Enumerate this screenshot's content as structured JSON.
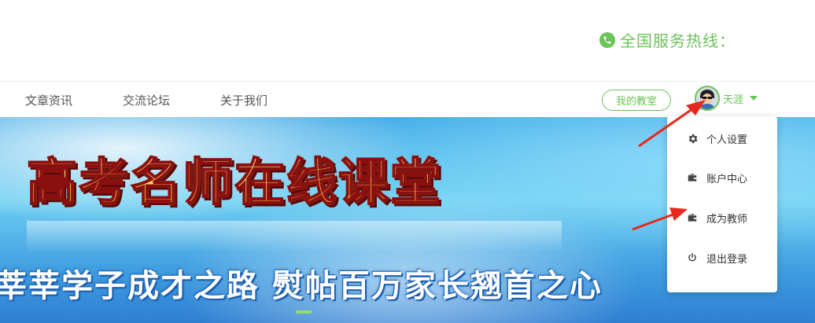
{
  "header": {
    "hotline_label": "全国服务热线：",
    "phone_icon": "phone-icon",
    "accent_color": "#6cc35a"
  },
  "nav": {
    "items": [
      {
        "label": "文章资讯"
      },
      {
        "label": "交流论坛"
      },
      {
        "label": "关于我们"
      }
    ],
    "classroom_button": "我的教室",
    "user_name": "天涯"
  },
  "banner": {
    "title": "高考名师在线课堂",
    "subtitle": "莘莘学子成才之路 熨帖百万家长翘首之心"
  },
  "dropdown": {
    "items": [
      {
        "label": "个人设置",
        "icon": "gear-icon"
      },
      {
        "label": "账户中心",
        "icon": "wallet-icon"
      },
      {
        "label": "成为教师",
        "icon": "wallet-icon"
      },
      {
        "label": "退出登录",
        "icon": "power-icon"
      }
    ]
  },
  "annotations": {
    "arrow_color": "#e8281e"
  }
}
